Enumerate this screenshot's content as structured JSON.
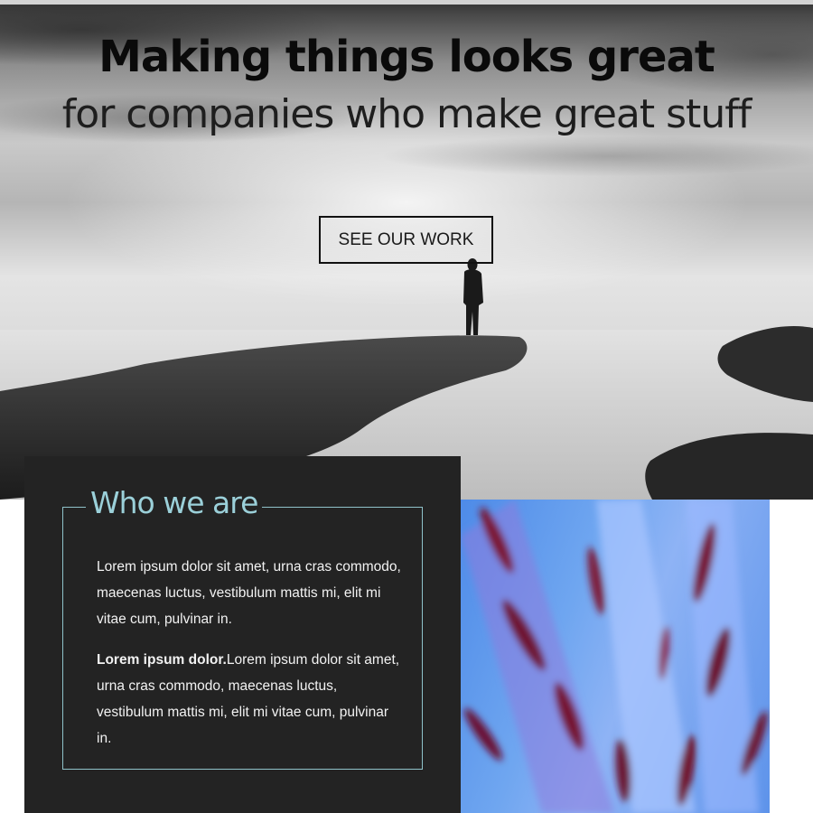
{
  "hero": {
    "title": "Making things looks great",
    "subtitle": "for companies who make great stuff",
    "cta_label": "SEE OUR WORK"
  },
  "about": {
    "title": "Who we are",
    "paragraph1": "Lorem ipsum dolor sit amet, urna cras commodo, maecenas luctus, vestibulum mattis mi, elit mi vitae cum, pulvinar in.",
    "paragraph2_bold": "Lorem ipsum dolor.",
    "paragraph2_rest": "Lorem ipsum dolor sit amet, urna cras commodo, maecenas luctus, vestibulum mattis mi, elit mi vitae cum, pulvinar in."
  },
  "colors": {
    "accent": "#9bd0d9",
    "card_background": "#232323",
    "hero_text": "#0a0a0a"
  }
}
